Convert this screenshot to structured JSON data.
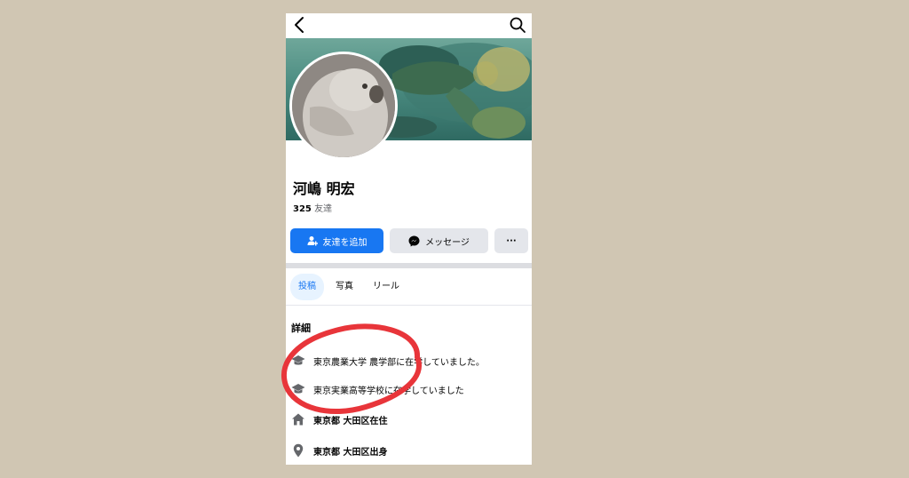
{
  "profile": {
    "name": "河嶋 明宏",
    "friends_count": "325",
    "friends_label": "友達"
  },
  "actions": {
    "add_friend_label": "友達を追加",
    "message_label": "メッセージ",
    "more_label": "···"
  },
  "tabs": [
    {
      "label": "投稿",
      "active": true
    },
    {
      "label": "写真",
      "active": false
    },
    {
      "label": "リール",
      "active": false
    }
  ],
  "details": {
    "title": "詳細",
    "items": [
      {
        "icon": "graduation-cap-icon",
        "text": "東京農業大学 農学部に在学していました。"
      },
      {
        "icon": "graduation-cap-icon",
        "text": "東京実業高等学校に在学していました"
      },
      {
        "icon": "home-icon",
        "text": "東京都 大田区在住"
      },
      {
        "icon": "location-pin-icon",
        "text": "東京都 大田区出身"
      }
    ]
  },
  "colors": {
    "accent": "#1877f2",
    "annotation": "#e8353a",
    "background": "#d0c6b3"
  }
}
